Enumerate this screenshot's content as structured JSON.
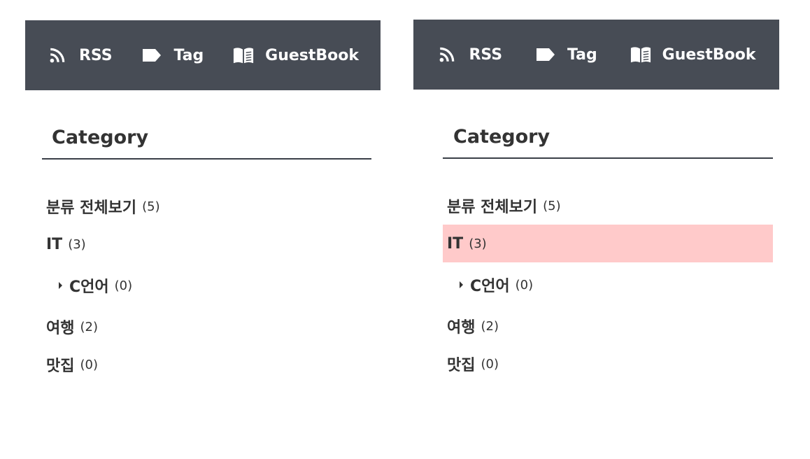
{
  "panels": [
    {
      "topbar": {
        "links": [
          {
            "label": "RSS",
            "icon": "rss-icon"
          },
          {
            "label": "Tag",
            "icon": "tag-icon"
          },
          {
            "label": "GuestBook",
            "icon": "book-icon"
          }
        ]
      },
      "category": {
        "title": "Category",
        "items": [
          {
            "label": "분류 전체보기",
            "count": "(5)"
          },
          {
            "label": "IT",
            "count": "(3)"
          },
          {
            "label": "C언어",
            "count": "(0)"
          },
          {
            "label": "여행",
            "count": "(2)"
          },
          {
            "label": "맛집",
            "count": "(0)"
          }
        ]
      }
    },
    {
      "topbar": {
        "links": [
          {
            "label": "RSS",
            "icon": "rss-icon"
          },
          {
            "label": "Tag",
            "icon": "tag-icon"
          },
          {
            "label": "GuestBook",
            "icon": "book-icon"
          }
        ]
      },
      "category": {
        "title": "Category",
        "highlight_color": "#ffcaca",
        "items": [
          {
            "label": "분류 전체보기",
            "count": "(5)"
          },
          {
            "label": "IT",
            "count": "(3)",
            "highlighted": true
          },
          {
            "label": "C언어",
            "count": "(0)"
          },
          {
            "label": "여행",
            "count": "(2)"
          },
          {
            "label": "맛집",
            "count": "(0)"
          }
        ]
      }
    }
  ],
  "colors": {
    "topbar_bg": "#474c55",
    "text": "#333333"
  }
}
